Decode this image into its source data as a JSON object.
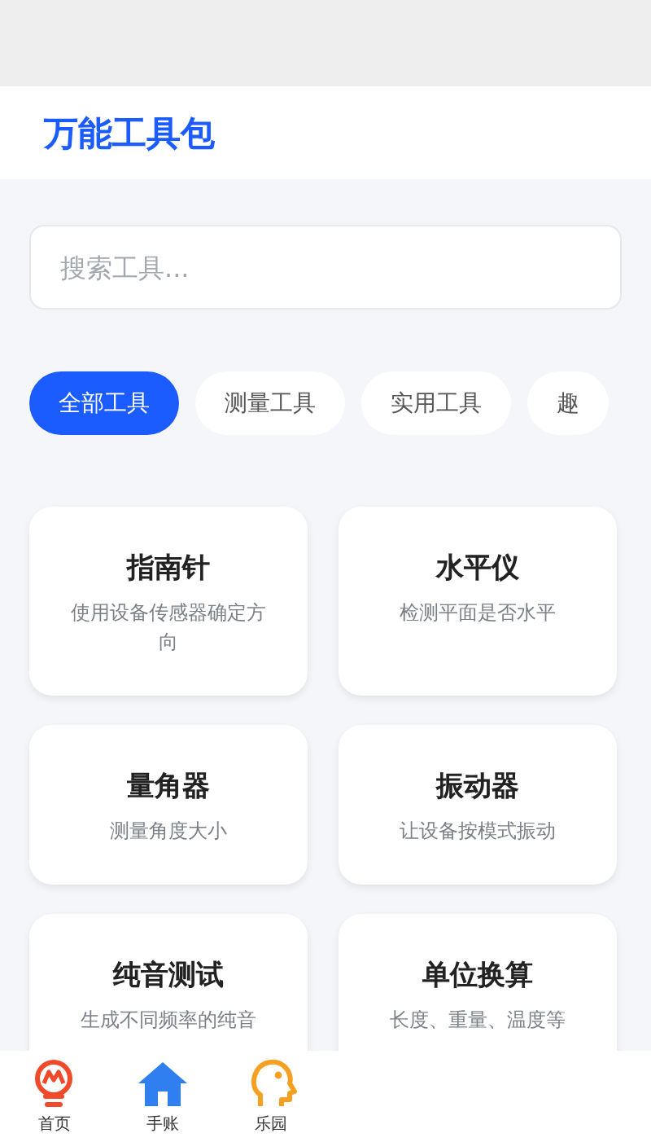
{
  "header": {
    "title": "万能工具包"
  },
  "search": {
    "placeholder": "搜索工具..."
  },
  "categories": [
    {
      "label": "全部工具",
      "selected": true
    },
    {
      "label": "测量工具",
      "selected": false
    },
    {
      "label": "实用工具",
      "selected": false
    },
    {
      "label": "趣",
      "selected": false
    }
  ],
  "tools": [
    {
      "name": "指南针",
      "description": "使用设备传感器确定方向"
    },
    {
      "name": "水平仪",
      "description": "检测平面是否水平"
    },
    {
      "name": "量角器",
      "description": "测量角度大小"
    },
    {
      "name": "振动器",
      "description": "让设备按模式振动"
    },
    {
      "name": "纯音测试",
      "description": "生成不同频率的纯音"
    },
    {
      "name": "单位换算",
      "description": "长度、重量、温度等"
    }
  ],
  "bottom_nav": [
    {
      "label": "首页",
      "kind": "bulb"
    },
    {
      "label": "手账",
      "kind": "house"
    },
    {
      "label": "乐园",
      "kind": "head"
    }
  ]
}
